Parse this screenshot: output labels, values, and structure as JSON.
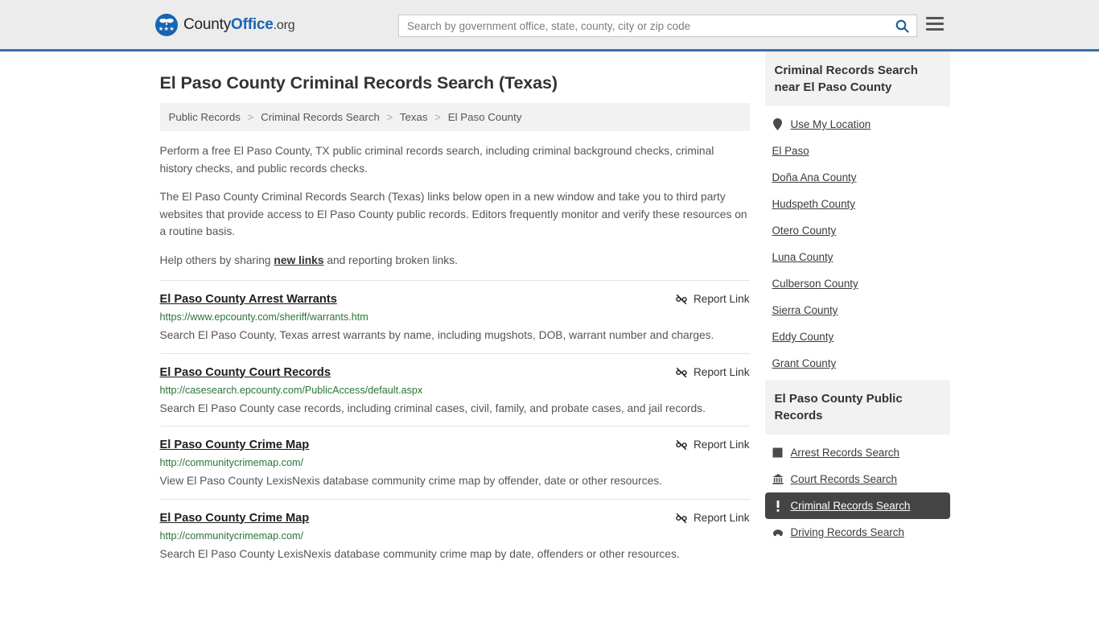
{
  "header": {
    "brand": {
      "part1": "County",
      "part2": "Office",
      "part3": ".org",
      "logo_icon": "eagle-seal-logo",
      "stars": "★★★"
    },
    "search": {
      "placeholder": "Search by government office, state, county, city or zip code",
      "value": "",
      "search_icon": "search-icon"
    },
    "menu_icon": "hamburger-menu-icon",
    "accent_color": "#3a6fa5"
  },
  "page": {
    "title": "El Paso County Criminal Records Search (Texas)",
    "breadcrumb": [
      {
        "label": "Public Records",
        "current": false
      },
      {
        "label": "Criminal Records Search",
        "current": false
      },
      {
        "label": "Texas",
        "current": false
      },
      {
        "label": "El Paso County",
        "current": true
      }
    ],
    "breadcrumb_separator": ">",
    "intro1": "Perform a free El Paso County, TX public criminal records search, including criminal background checks, criminal history checks, and public records checks.",
    "intro2": "The El Paso County Criminal Records Search (Texas) links below open in a new window and take you to third party websites that provide access to El Paso County public records. Editors frequently monitor and verify these resources on a routine basis.",
    "intro3_before": "Help others by sharing ",
    "intro3_link": "new links",
    "intro3_after": " and reporting broken links."
  },
  "report_link": {
    "label": "Report Link",
    "icon": "broken-link-icon"
  },
  "results": [
    {
      "title": "El Paso County Arrest Warrants",
      "url": "https://www.epcounty.com/sheriff/warrants.htm",
      "description": "Search El Paso County, Texas arrest warrants by name, including mugshots, DOB, warrant number and charges."
    },
    {
      "title": "El Paso County Court Records",
      "url": "http://casesearch.epcounty.com/PublicAccess/default.aspx",
      "description": "Search El Paso County case records, including criminal cases, civil, family, and probate cases, and jail records."
    },
    {
      "title": "El Paso County Crime Map",
      "url": "http://communitycrimemap.com/",
      "description": "View El Paso County LexisNexis database community crime map by offender, date or other resources."
    },
    {
      "title": "El Paso County Crime Map",
      "url": "http://communitycrimemap.com/",
      "description": "Search El Paso County LexisNexis database community crime map by date, offenders or other resources."
    }
  ],
  "sidebar": {
    "nearby": {
      "heading": "Criminal Records Search near El Paso County",
      "items": [
        {
          "label": "Use My Location",
          "icon": "map-pin-icon"
        },
        {
          "label": "El Paso",
          "icon": ""
        },
        {
          "label": "Doña Ana County",
          "icon": ""
        },
        {
          "label": "Hudspeth County",
          "icon": ""
        },
        {
          "label": "Otero County",
          "icon": ""
        },
        {
          "label": "Luna County",
          "icon": ""
        },
        {
          "label": "Culberson County",
          "icon": ""
        },
        {
          "label": "Sierra County",
          "icon": ""
        },
        {
          "label": "Eddy County",
          "icon": ""
        },
        {
          "label": "Grant County",
          "icon": ""
        }
      ]
    },
    "public_records": {
      "heading": "El Paso County Public Records",
      "items": [
        {
          "label": "Arrest Records Search",
          "icon": "fingerprint-icon",
          "active": false
        },
        {
          "label": "Court Records Search",
          "icon": "courthouse-icon",
          "active": false
        },
        {
          "label": "Criminal Records Search",
          "icon": "exclamation-icon",
          "active": true
        },
        {
          "label": "Driving Records Search",
          "icon": "car-icon",
          "active": false
        }
      ]
    }
  }
}
